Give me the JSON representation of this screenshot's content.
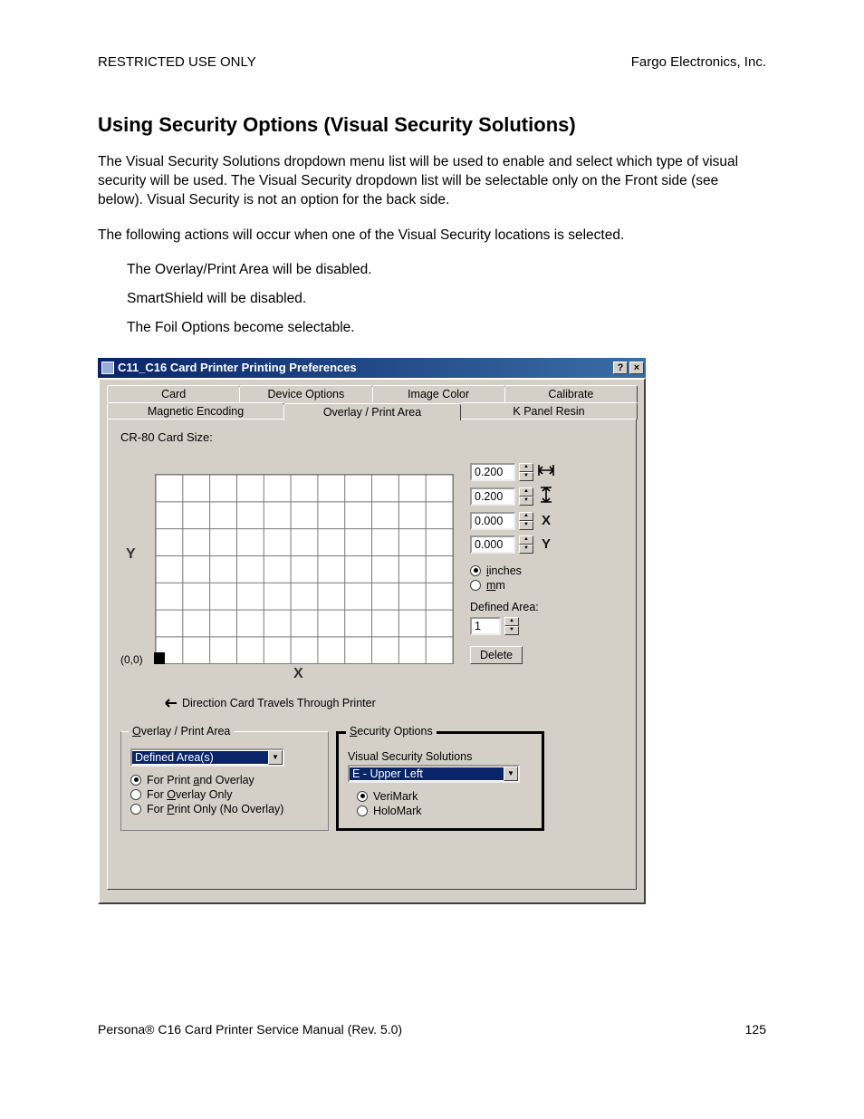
{
  "header": {
    "left": "RESTRICTED USE ONLY",
    "right": "Fargo Electronics, Inc."
  },
  "title": "Using Security Options (Visual Security Solutions)",
  "para1": "The Visual Security Solutions dropdown menu list will be used to enable and select which type of visual security will be used. The Visual Security dropdown list will be selectable only on the Front side (see below). Visual Security is not an option for the back side.",
  "para2": "The following actions will occur when one of the Visual Security locations is selected.",
  "bullets": {
    "b0": "The Overlay/Print Area will be disabled.",
    "b1": "SmartShield will be disabled.",
    "b2": "The Foil Options become selectable."
  },
  "dialog": {
    "title": "C11_C16 Card Printer Printing Preferences",
    "help": "?",
    "close": "×",
    "tabs_upper": {
      "t0": "Card",
      "t1": "Device Options",
      "t2": "Image Color",
      "t3": "Calibrate"
    },
    "tabs_lower": {
      "t0": "Magnetic Encoding",
      "t1": "Overlay / Print Area",
      "t2": "K Panel Resin"
    },
    "cardsize": "CR-80 Card Size:",
    "y": "Y",
    "x": "X",
    "origin": "(0,0)",
    "direction": "Direction Card Travels Through Printer",
    "spins": {
      "w": "0.200",
      "h": "0.200",
      "px": "0.000",
      "py": "0.000"
    },
    "dimicons": {
      "w": "↔",
      "h": "↕",
      "px": "X",
      "py": "Y"
    },
    "units": {
      "inches_label": "inches",
      "mm_label": "mm"
    },
    "defarea": {
      "label": "Defined Area:",
      "value": "1",
      "delete": "Delete"
    },
    "overlay": {
      "title": "Overlay / Print Area",
      "combo": "Defined Area(s)",
      "r0": "For Print and Overlay",
      "r1": "For Overlay Only",
      "r2": "For Print Only (No Overlay)",
      "u0": "a",
      "u1": "O",
      "u2": "P"
    },
    "security": {
      "title": "Security Options",
      "vss_label": "Visual Security Solutions",
      "combo": "E - Upper Left",
      "r0": "VeriMark",
      "r1": "HoloMark"
    }
  },
  "footer": {
    "left": "Persona® C16 Card Printer Service Manual (Rev. 5.0)",
    "right": "125"
  }
}
